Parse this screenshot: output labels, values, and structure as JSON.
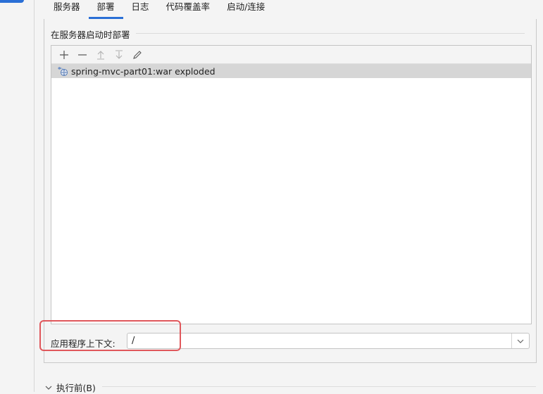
{
  "tabs": [
    {
      "label": "服务器",
      "active": false
    },
    {
      "label": "部署",
      "active": true
    },
    {
      "label": "日志",
      "active": false
    },
    {
      "label": "代码覆盖率",
      "active": false
    },
    {
      "label": "启动/连接",
      "active": false
    }
  ],
  "deploy_group": {
    "title": "在服务器启动时部署",
    "toolbar": {
      "icons": [
        "add-icon",
        "remove-icon",
        "move-up-icon",
        "move-down-icon",
        "edit-icon"
      ]
    },
    "artifacts": [
      {
        "label": "spring-mvc-part01:war exploded",
        "icon": "artifact-icon",
        "selected": true
      }
    ]
  },
  "context": {
    "label": "应用程序上下文:",
    "value": "/"
  },
  "before_launch": {
    "label": "执行前(B)",
    "expanded": false
  },
  "colors": {
    "accent": "#2a6fd6",
    "selection": "#d6d6d6",
    "highlight": "#e0575b"
  }
}
